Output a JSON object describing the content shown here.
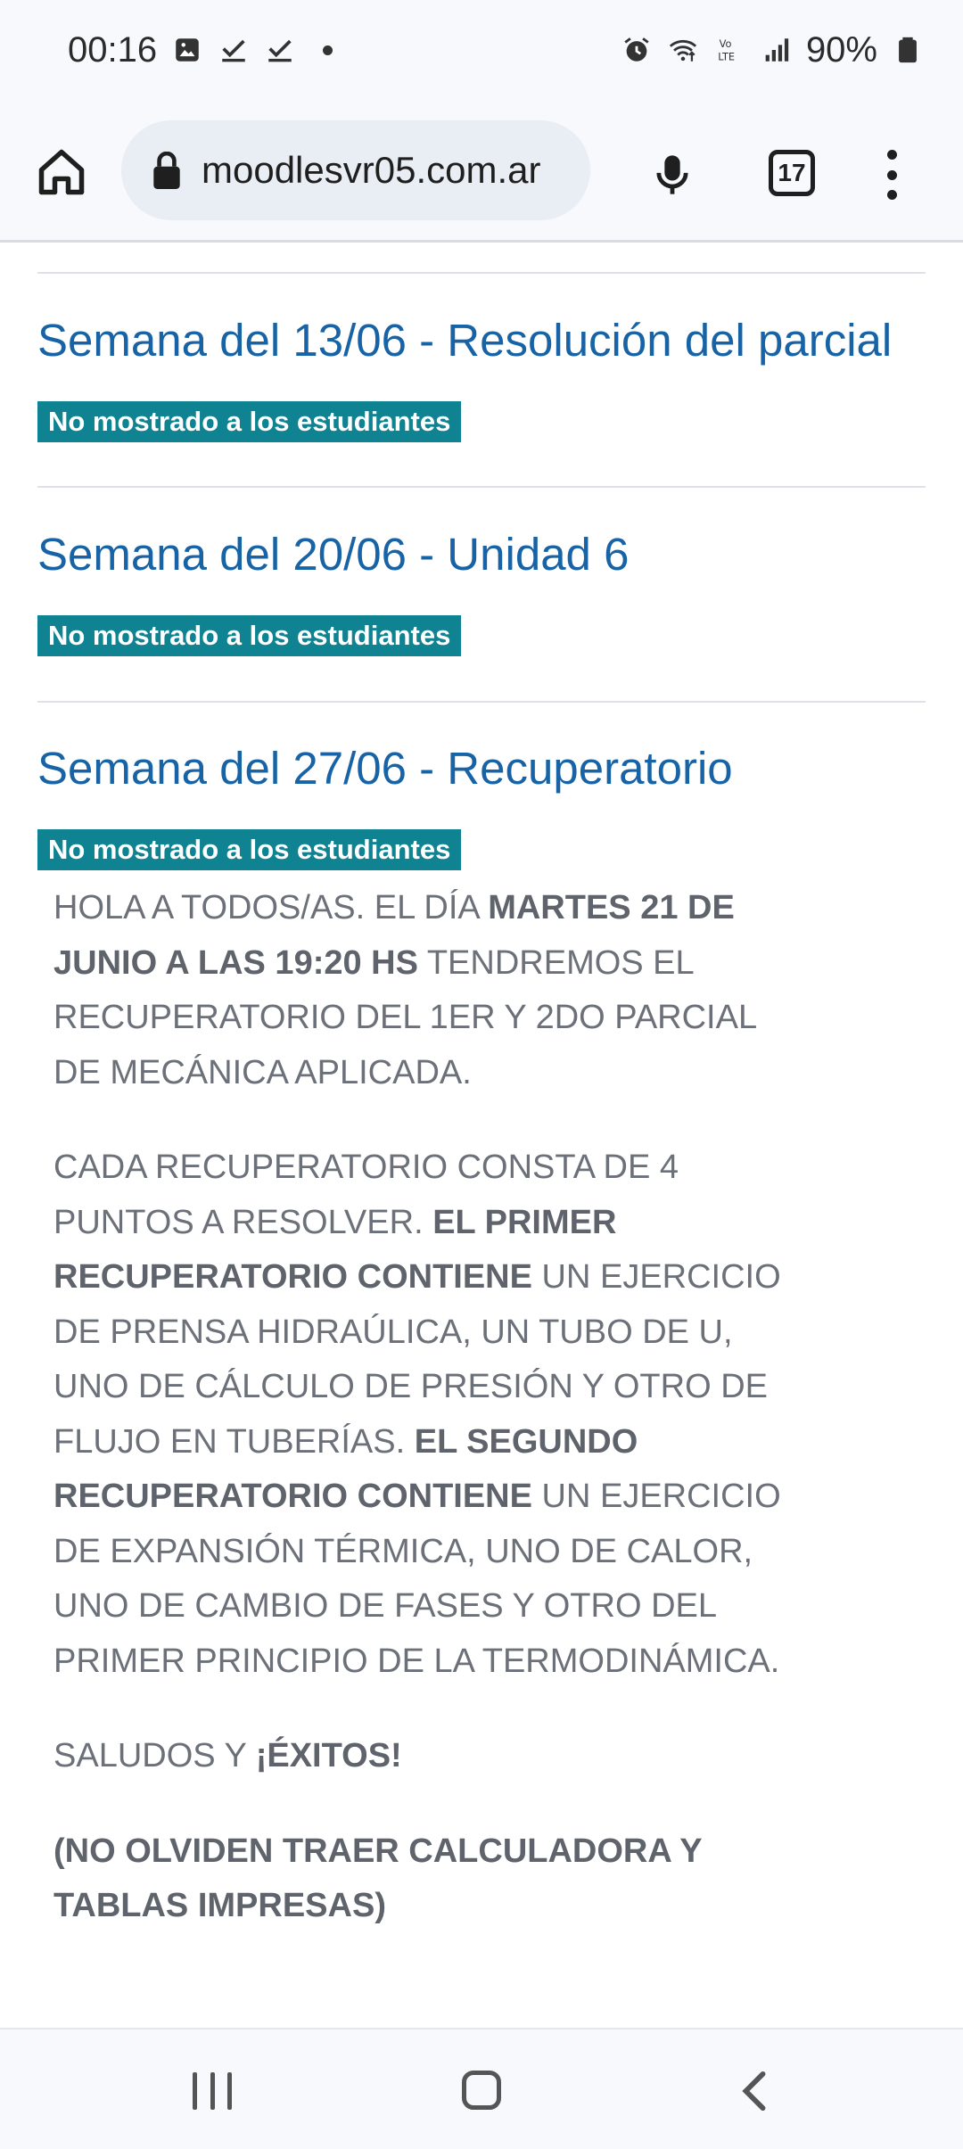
{
  "status_bar": {
    "time": "00:16",
    "left_icons": [
      "image-icon",
      "check-icon",
      "check-icon",
      "dot-icon"
    ],
    "right_icons": [
      "alarm-icon",
      "wifi-icon",
      "volte-icon",
      "signal-icon"
    ],
    "battery": "90%"
  },
  "browser": {
    "url": "moodlesvr05.com.ar",
    "tab_count": "17"
  },
  "sections": [
    {
      "title": "Semana del 13/06 - Resolución del parcial",
      "badge": "No mostrado a los estudiantes"
    },
    {
      "title": "Semana del 20/06 - Unidad 6",
      "badge": "No mostrado a los estudiantes"
    },
    {
      "title": "Semana del 27/06 - Recuperatorio",
      "badge": "No mostrado a los estudiantes"
    }
  ],
  "summary": {
    "p1_a": "HOLA A TODOS/AS. EL DÍA ",
    "p1_b": "MARTES 21 DE JUNIO A LAS 19:20 HS",
    "p1_c": " TENDREMOS EL RECUPERATORIO DEL 1ER Y 2DO PARCIAL DE MECÁNICA APLICADA.",
    "p2_a": "CADA RECUPERATORIO CONSTA DE 4 PUNTOS A RESOLVER. ",
    "p2_b": "EL PRIMER RECUPERATORIO CONTIENE",
    "p2_c": " UN EJERCICIO DE PRENSA HIDRAÚLICA, UN TUBO DE U, UNO DE CÁLCULO DE PRESIÓN Y OTRO DE FLUJO EN TUBERÍAS. ",
    "p2_d": "EL SEGUNDO RECUPERATORIO CONTIENE",
    "p2_e": " UN EJERCICIO DE EXPANSIÓN TÉRMICA, UNO DE CALOR, UNO DE CAMBIO DE FASES Y OTRO DEL PRIMER PRINCIPIO DE LA TERMODINÁMICA.",
    "p3_a": "SALUDOS Y ",
    "p3_b": "¡ÉXITOS!",
    "p4": "(NO OLVIDEN TRAER CALCULADORA Y TABLAS IMPRESAS)"
  },
  "colors": {
    "link": "#1763a6",
    "badge_bg": "#0f8391",
    "summary_text": "#6b7079"
  }
}
